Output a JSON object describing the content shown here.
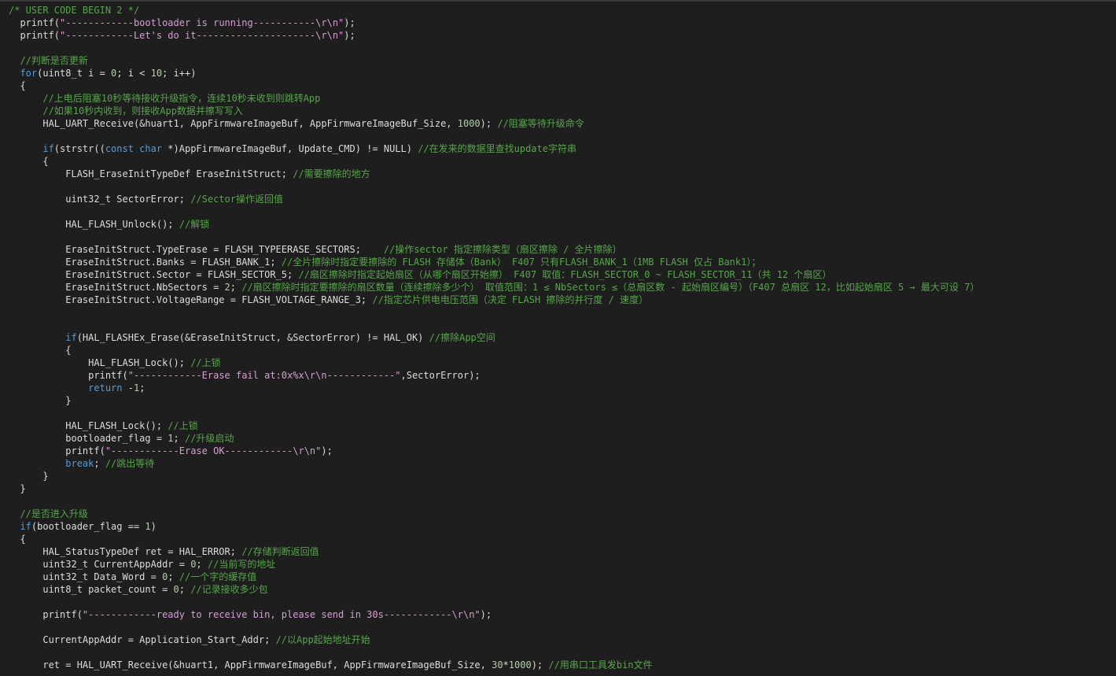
{
  "editor": {
    "theme_colors": {
      "background": "#1e1e1e",
      "plain": "#dcdcdc",
      "keyword": "#569cd6",
      "string": "#d69dd6",
      "comment": "#57a64a",
      "number": "#b5cea8"
    },
    "lines": [
      [
        [
          "c",
          "/* USER CODE BEGIN 2 */"
        ]
      ],
      [
        [
          "p",
          "  printf("
        ],
        [
          "s",
          "\"------------bootloader is running-----------\\r\\n\""
        ],
        [
          "p",
          ");"
        ]
      ],
      [
        [
          "p",
          "  printf("
        ],
        [
          "s",
          "\"------------Let's do it---------------------\\r\\n\""
        ],
        [
          "p",
          ");"
        ]
      ],
      [
        [
          "p",
          ""
        ]
      ],
      [
        [
          "c",
          "  //判断是否更新"
        ]
      ],
      [
        [
          "k",
          "  for"
        ],
        [
          "p",
          "(uint8_t i = "
        ],
        [
          "n",
          "0"
        ],
        [
          "p",
          "; i < "
        ],
        [
          "n",
          "10"
        ],
        [
          "p",
          "; i++)"
        ]
      ],
      [
        [
          "p",
          "  {"
        ]
      ],
      [
        [
          "c",
          "      //上电后阻塞10秒等待接收升级指令，连续10秒未收到则跳转App"
        ]
      ],
      [
        [
          "c",
          "      //如果10秒内收到，则接收App数据并擦写写入"
        ]
      ],
      [
        [
          "p",
          "      HAL_UART_Receive(&huart1, AppFirmwareImageBuf, AppFirmwareImageBuf_Size, "
        ],
        [
          "n",
          "1000"
        ],
        [
          "p",
          "); "
        ],
        [
          "c",
          "//阻塞等待升级命令"
        ]
      ],
      [
        [
          "p",
          ""
        ]
      ],
      [
        [
          "k",
          "      if"
        ],
        [
          "p",
          "(strstr(("
        ],
        [
          "k",
          "const char"
        ],
        [
          "p",
          " *)AppFirmwareImageBuf, Update_CMD) != NULL) "
        ],
        [
          "c",
          "//在发来的数据里查找update字符串"
        ]
      ],
      [
        [
          "p",
          "      {"
        ]
      ],
      [
        [
          "p",
          "          FLASH_EraseInitTypeDef EraseInitStruct; "
        ],
        [
          "c",
          "//需要擦除的地方"
        ]
      ],
      [
        [
          "p",
          ""
        ]
      ],
      [
        [
          "p",
          "          uint32_t SectorError; "
        ],
        [
          "c",
          "//Sector操作返回值"
        ]
      ],
      [
        [
          "p",
          ""
        ]
      ],
      [
        [
          "p",
          "          HAL_FLASH_Unlock(); "
        ],
        [
          "c",
          "//解锁"
        ]
      ],
      [
        [
          "p",
          ""
        ]
      ],
      [
        [
          "p",
          "          EraseInitStruct.TypeErase = FLASH_TYPEERASE_SECTORS;    "
        ],
        [
          "c",
          "//操作sector 指定擦除类型（扇区擦除 / 全片擦除）"
        ]
      ],
      [
        [
          "p",
          "          EraseInitStruct.Banks = FLASH_BANK_1; "
        ],
        [
          "c",
          "//全片擦除时指定要擦除的 FLASH 存储体（Bank） F407 只有FLASH_BANK_1（1MB FLASH 仅占 Bank1）；"
        ]
      ],
      [
        [
          "p",
          "          EraseInitStruct.Sector = FLASH_SECTOR_5; "
        ],
        [
          "c",
          "//扇区擦除时指定起始扇区（从哪个扇区开始擦） F407 取值：FLASH_SECTOR_0 ~ FLASH_SECTOR_11（共 12 个扇区）"
        ]
      ],
      [
        [
          "p",
          "          EraseInitStruct.NbSectors = "
        ],
        [
          "n",
          "2"
        ],
        [
          "p",
          "; "
        ],
        [
          "c",
          "//扇区擦除时指定要擦除的扇区数量（连续擦除多少个） 取值范围：1 ≤ NbSectors ≤（总扇区数 - 起始扇区编号）（F407 总扇区 12，比如起始扇区 5 → 最大可设 7）"
        ]
      ],
      [
        [
          "p",
          "          EraseInitStruct.VoltageRange = FLASH_VOLTAGE_RANGE_3; "
        ],
        [
          "c",
          "//指定芯片供电电压范围（决定 FLASH 擦除的并行度 / 速度）"
        ]
      ],
      [
        [
          "p",
          ""
        ]
      ],
      [
        [
          "p",
          ""
        ]
      ],
      [
        [
          "k",
          "          if"
        ],
        [
          "p",
          "(HAL_FLASHEx_Erase(&EraseInitStruct, &SectorError) != HAL_OK) "
        ],
        [
          "c",
          "//擦除App空间"
        ]
      ],
      [
        [
          "p",
          "          {"
        ]
      ],
      [
        [
          "p",
          "              HAL_FLASH_Lock(); "
        ],
        [
          "c",
          "//上锁"
        ]
      ],
      [
        [
          "p",
          "              printf("
        ],
        [
          "s",
          "\"------------Erase fail at:0x%x\\r\\n------------\""
        ],
        [
          "p",
          ",SectorError);"
        ]
      ],
      [
        [
          "k",
          "              return"
        ],
        [
          "p",
          " -"
        ],
        [
          "n",
          "1"
        ],
        [
          "p",
          ";"
        ]
      ],
      [
        [
          "p",
          "          }"
        ]
      ],
      [
        [
          "p",
          ""
        ]
      ],
      [
        [
          "p",
          "          HAL_FLASH_Lock(); "
        ],
        [
          "c",
          "//上锁"
        ]
      ],
      [
        [
          "p",
          "          bootloader_flag = "
        ],
        [
          "n",
          "1"
        ],
        [
          "p",
          "; "
        ],
        [
          "c",
          "//升级启动"
        ]
      ],
      [
        [
          "p",
          "          printf("
        ],
        [
          "s",
          "\"------------Erase OK------------\\r\\n\""
        ],
        [
          "p",
          ");"
        ]
      ],
      [
        [
          "k",
          "          break"
        ],
        [
          "p",
          "; "
        ],
        [
          "c",
          "//跳出等待"
        ]
      ],
      [
        [
          "p",
          "      }"
        ]
      ],
      [
        [
          "p",
          "  }"
        ]
      ],
      [
        [
          "p",
          ""
        ]
      ],
      [
        [
          "c",
          "  //是否进入升级"
        ]
      ],
      [
        [
          "k",
          "  if"
        ],
        [
          "p",
          "(bootloader_flag == "
        ],
        [
          "n",
          "1"
        ],
        [
          "p",
          ")"
        ]
      ],
      [
        [
          "p",
          "  {"
        ]
      ],
      [
        [
          "p",
          "      HAL_StatusTypeDef ret = HAL_ERROR; "
        ],
        [
          "c",
          "//存储判断返回值"
        ]
      ],
      [
        [
          "p",
          "      uint32_t CurrentAppAddr = "
        ],
        [
          "n",
          "0"
        ],
        [
          "p",
          "; "
        ],
        [
          "c",
          "//当前写的地址"
        ]
      ],
      [
        [
          "p",
          "      uint32_t Data_Word = "
        ],
        [
          "n",
          "0"
        ],
        [
          "p",
          "; "
        ],
        [
          "c",
          "//一个字的缓存值"
        ]
      ],
      [
        [
          "p",
          "      uint8_t packet_count = "
        ],
        [
          "n",
          "0"
        ],
        [
          "p",
          "; "
        ],
        [
          "c",
          "//记录接收多少包"
        ]
      ],
      [
        [
          "p",
          ""
        ]
      ],
      [
        [
          "p",
          "      printf("
        ],
        [
          "s",
          "\"------------ready to receive bin, please send in 30s------------\\r\\n\""
        ],
        [
          "p",
          ");"
        ]
      ],
      [
        [
          "p",
          ""
        ]
      ],
      [
        [
          "p",
          "      CurrentAppAddr = Application_Start_Addr; "
        ],
        [
          "c",
          "//以App起始地址开始"
        ]
      ],
      [
        [
          "p",
          ""
        ]
      ],
      [
        [
          "p",
          "      ret = HAL_UART_Receive(&huart1, AppFirmwareImageBuf, AppFirmwareImageBuf_Size, "
        ],
        [
          "n",
          "30"
        ],
        [
          "p",
          "*"
        ],
        [
          "n",
          "1000"
        ],
        [
          "p",
          "); "
        ],
        [
          "c",
          "//用串口工具发bin文件"
        ]
      ]
    ]
  }
}
